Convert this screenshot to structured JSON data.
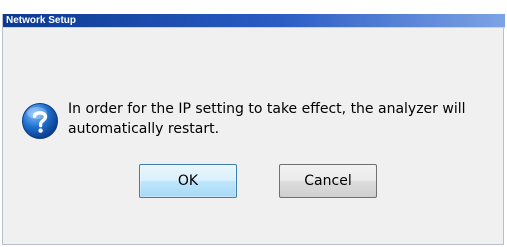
{
  "window": {
    "title": "Network Setup"
  },
  "dialog": {
    "icon": "question-icon",
    "message": "In order for the IP setting to take effect, the analyzer will\nautomatically restart."
  },
  "buttons": {
    "ok_label": "OK",
    "cancel_label": "Cancel"
  },
  "colors": {
    "title_bar_start": "#0b3a92",
    "title_bar_end": "#7da3e6",
    "icon_blue": "#1f6fce",
    "default_button_border": "#3c7fb1"
  }
}
